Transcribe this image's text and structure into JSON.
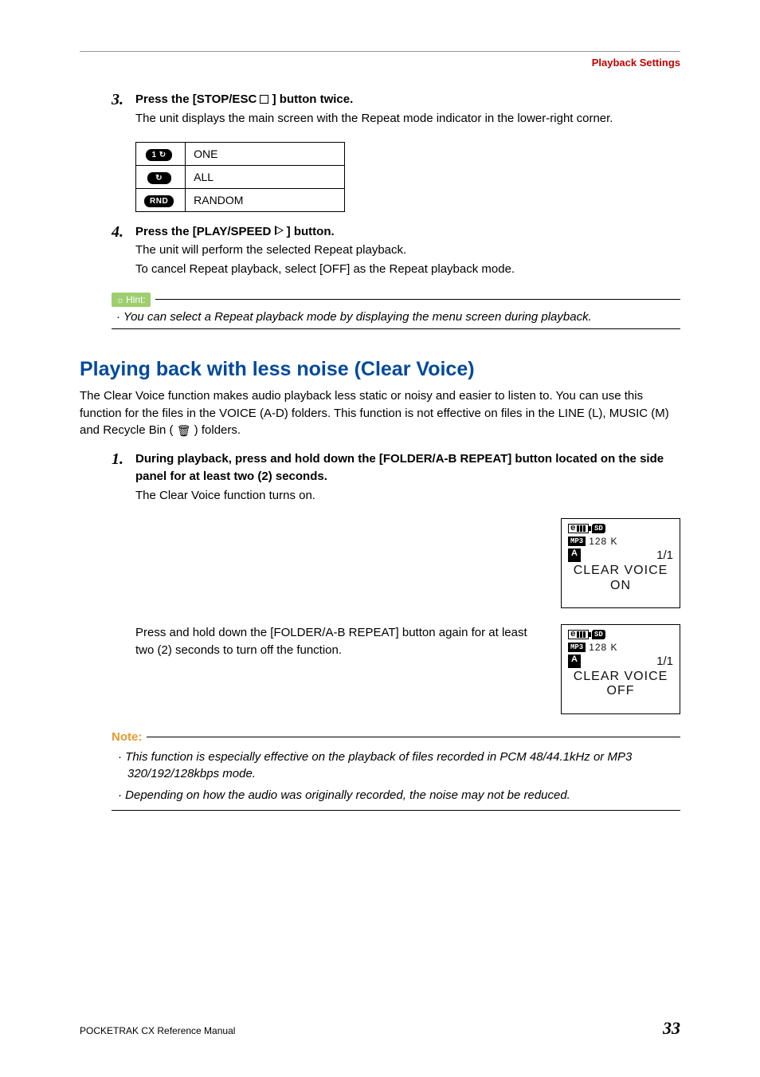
{
  "header": {
    "section": "Playback Settings"
  },
  "step3": {
    "num": "3.",
    "title_a": "Press the [STOP/ESC ",
    "title_b": " ] button twice.",
    "desc": "The unit displays the main screen with the Repeat mode indicator in the lower-right corner."
  },
  "repeat_table": [
    {
      "icon": "1 ↻",
      "label": "ONE"
    },
    {
      "icon": "↻",
      "label": "ALL"
    },
    {
      "icon": "RND",
      "label": "RANDOM"
    }
  ],
  "step4": {
    "num": "4.",
    "title_a": "Press the [PLAY/SPEED ",
    "title_b": " ] button.",
    "desc1": "The unit will perform the selected Repeat playback.",
    "desc2": "To cancel Repeat playback, select [OFF] as the Repeat playback mode."
  },
  "hint": {
    "label": "Hint:",
    "bullet": "· You can select a Repeat playback mode by displaying the menu screen during playback."
  },
  "section2": {
    "title": "Playing back with less noise (Clear Voice)",
    "para_a": "The Clear Voice function makes audio playback less static or noisy and easier to listen to. You can use this function for the files in the VOICE (A-D) folders. This function is not effective on files in the LINE (L), MUSIC (M) and Recycle Bin ( ",
    "para_b": " ) folders."
  },
  "step1": {
    "num": "1.",
    "title": "During playback, press and hold down the [FOLDER/A-B REPEAT] button located on the side panel for at least two (2) seconds.",
    "desc": "The Clear Voice function turns on.",
    "press_again": "Press and hold down the [FOLDER/A-B REPEAT] button again for at least two (2) seconds to turn off the function."
  },
  "lcd_on": {
    "sd": "SD",
    "mp3": "MP3",
    "rate": "128 K",
    "folder": "A",
    "counter": "1/1",
    "line1": "CLEAR VOICE",
    "line2": "ON"
  },
  "lcd_off": {
    "sd": "SD",
    "mp3": "MP3",
    "rate": "128 K",
    "folder": "A",
    "counter": "1/1",
    "line1": "CLEAR VOICE",
    "line2": "OFF"
  },
  "note": {
    "label": "Note:",
    "b1": "· This function is especially effective on the playback of files recorded in PCM 48/44.1kHz or MP3 320/192/128kbps mode.",
    "b2": "· Depending on how the audio was originally recorded, the noise may not be reduced."
  },
  "footer": {
    "left": "POCKETRAK CX   Reference Manual",
    "right": "33"
  }
}
